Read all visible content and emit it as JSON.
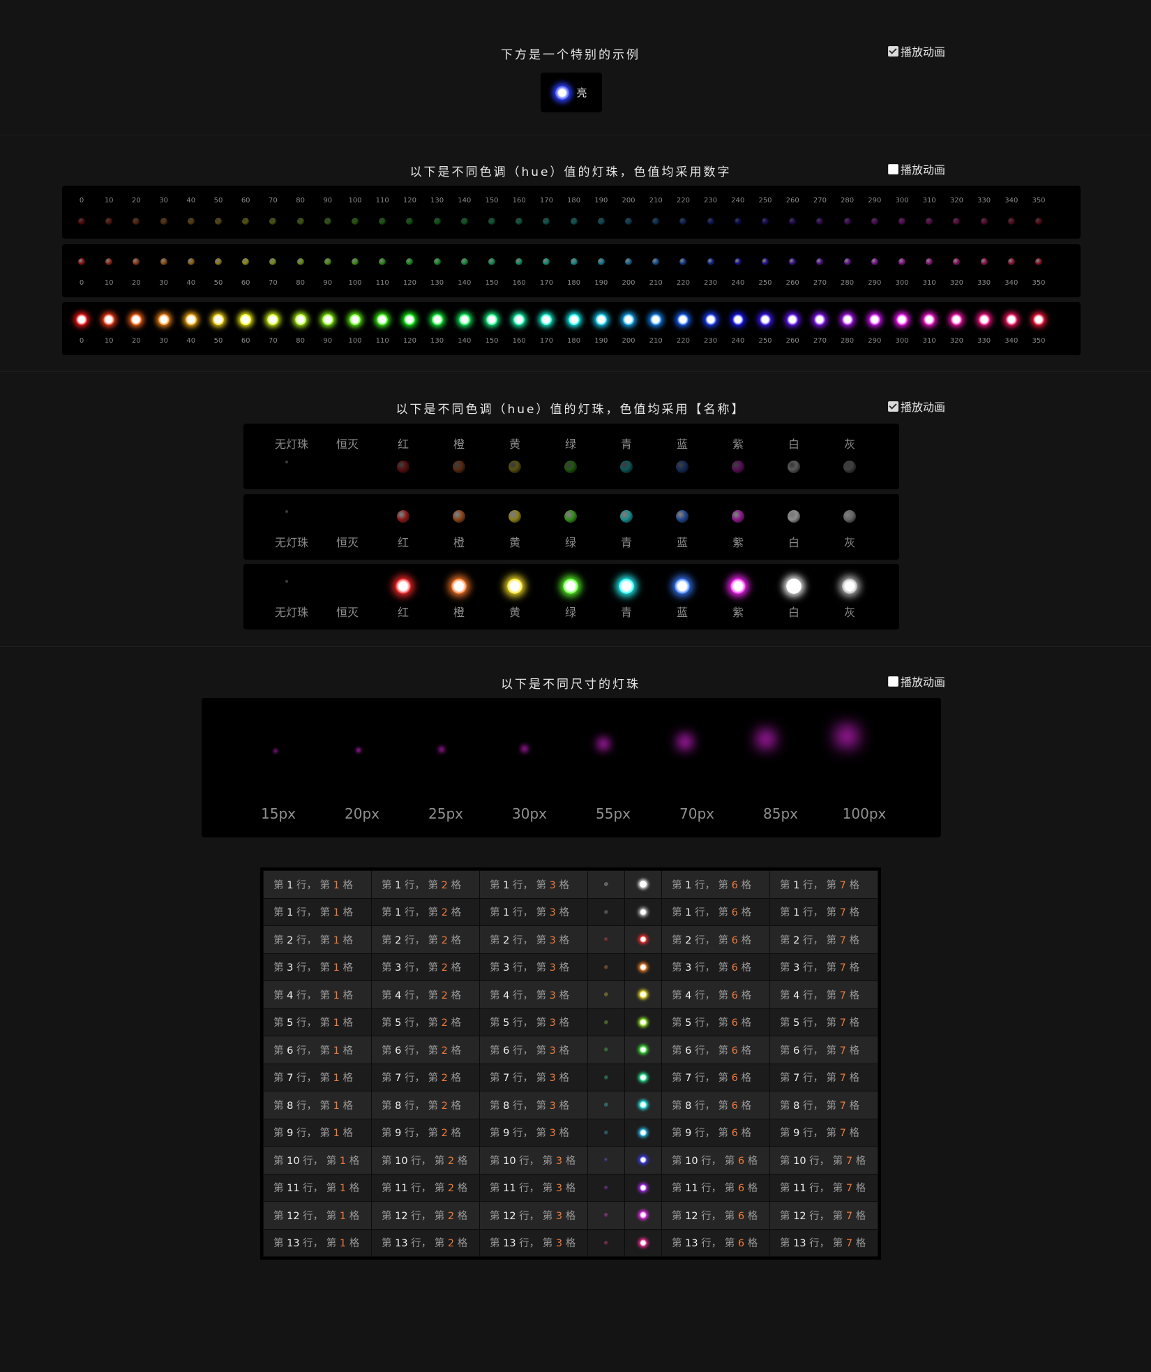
{
  "section_special": {
    "title": "下方是一个特别的示例",
    "animate_label": "播放动画",
    "animate_checked": true,
    "demo_text": "亮",
    "demo_color": "#3a5bff"
  },
  "section_hue_numbers": {
    "title": "以下是不同色调（hue）值的灯珠，色值均采用数字",
    "animate_label": "播放动画",
    "animate_checked": false,
    "hues": [
      0,
      10,
      20,
      30,
      40,
      50,
      60,
      70,
      80,
      90,
      100,
      110,
      120,
      130,
      140,
      150,
      160,
      170,
      180,
      190,
      200,
      210,
      220,
      230,
      240,
      250,
      260,
      270,
      280,
      290,
      300,
      310,
      320,
      330,
      340,
      350
    ]
  },
  "section_hue_names": {
    "title": "以下是不同色调（hue）值的灯珠，色值均采用【名称】",
    "animate_label": "播放动画",
    "animate_checked": true,
    "names": [
      "无灯珠",
      "恒灭",
      "红",
      "橙",
      "黄",
      "绿",
      "青",
      "蓝",
      "紫",
      "白",
      "灰"
    ],
    "colors": [
      "none",
      "off",
      "#ff2a2a",
      "#ff7a2a",
      "#ffe62a",
      "#5aff2a",
      "#2affff",
      "#3a7cff",
      "#ff2aff",
      "#ffffff",
      "#b5b5b5"
    ]
  },
  "section_sizes": {
    "title": "以下是不同尺寸的灯珠",
    "animate_label": "播放动画",
    "animate_checked": false,
    "sizes": [
      "15px",
      "20px",
      "25px",
      "30px",
      "55px",
      "70px",
      "85px",
      "100px"
    ],
    "color": "#ff2aff"
  },
  "table": {
    "row_word": "行",
    "cell_word": "格",
    "prefix": "第",
    "separator": "，",
    "row_labels": [
      "1",
      "1",
      "2",
      "3",
      "4",
      "5",
      "6",
      "7",
      "8",
      "9",
      "10",
      "11",
      "12",
      "13"
    ],
    "text_columns": [
      "1",
      "2",
      "3",
      "6",
      "7"
    ],
    "bead_colors": [
      "#ffffff",
      "#b5b5b5",
      "#ff2a2a",
      "#ff8a2a",
      "#ffee2a",
      "#a0ff2a",
      "#3aff3a",
      "#2affa0",
      "#2affff",
      "#2ac8ff",
      "#3a3aff",
      "#b02aff",
      "#ff2aff",
      "#ff2a9a"
    ]
  }
}
